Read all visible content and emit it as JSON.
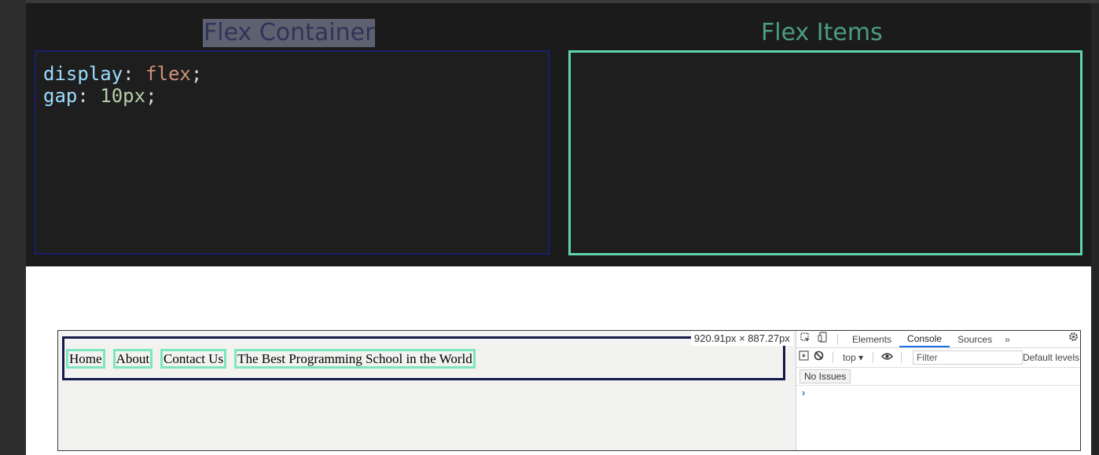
{
  "colors": {
    "container_border": "#1a1f6b",
    "items_border": "#5fd3aa",
    "nav_outline": "#141a4a",
    "nav_item_border": "#7ee6be"
  },
  "panels": {
    "container_title": "Flex Container",
    "items_title": "Flex Items"
  },
  "code": {
    "line1": {
      "prop": "display",
      "colon": ":",
      "value": "flex",
      "semi": ";"
    },
    "line2": {
      "prop": "gap",
      "colon": ":",
      "value": "10px",
      "semi": ";"
    }
  },
  "preview": {
    "size_tooltip": "920.91px × 887.27px",
    "nav_items": [
      "Home",
      "About",
      "Contact Us",
      "The Best Programming School in the World"
    ]
  },
  "devtools": {
    "icons": [
      "inspect-icon",
      "device-toggle-icon",
      "sidebar-toggle-icon",
      "clear-console-icon",
      "eye-icon",
      "gear-icon"
    ],
    "tabs": [
      "Elements",
      "Console",
      "Sources"
    ],
    "active_tab": "Console",
    "more_tabs": "»",
    "context": "top ▾",
    "filter_placeholder": "Filter",
    "levels": "Default levels",
    "issues": "No Issues",
    "prompt": "›"
  }
}
